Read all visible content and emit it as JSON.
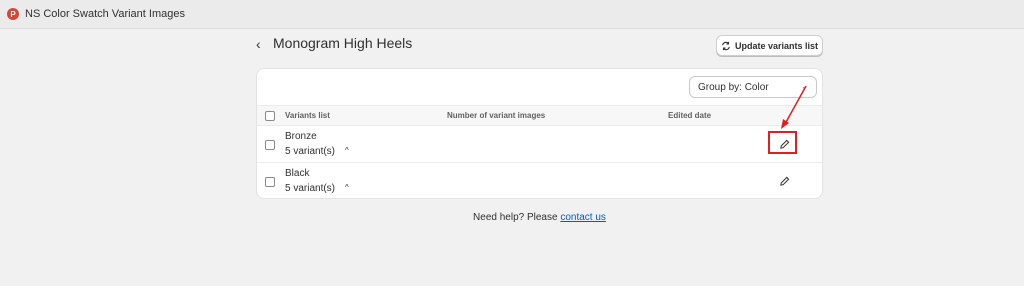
{
  "app": {
    "icon_letter": "P",
    "title": "NS Color Swatch Variant Images"
  },
  "header": {
    "back_symbol": "‹",
    "title": "Monogram High Heels",
    "update_button": "Update variants list"
  },
  "filter": {
    "group_by": "Group by: Color"
  },
  "table": {
    "columns": [
      "Variants list",
      "Number of variant images",
      "Edited date"
    ],
    "rows": [
      {
        "name": "Bronze",
        "variants": "5 variant(s)"
      },
      {
        "name": "Black",
        "variants": "5 variant(s)"
      }
    ]
  },
  "footer": {
    "help_text": "Need help? Please",
    "help_link": "contact us"
  },
  "colors": {
    "highlight": "#e02020",
    "link": "#005bd3"
  }
}
